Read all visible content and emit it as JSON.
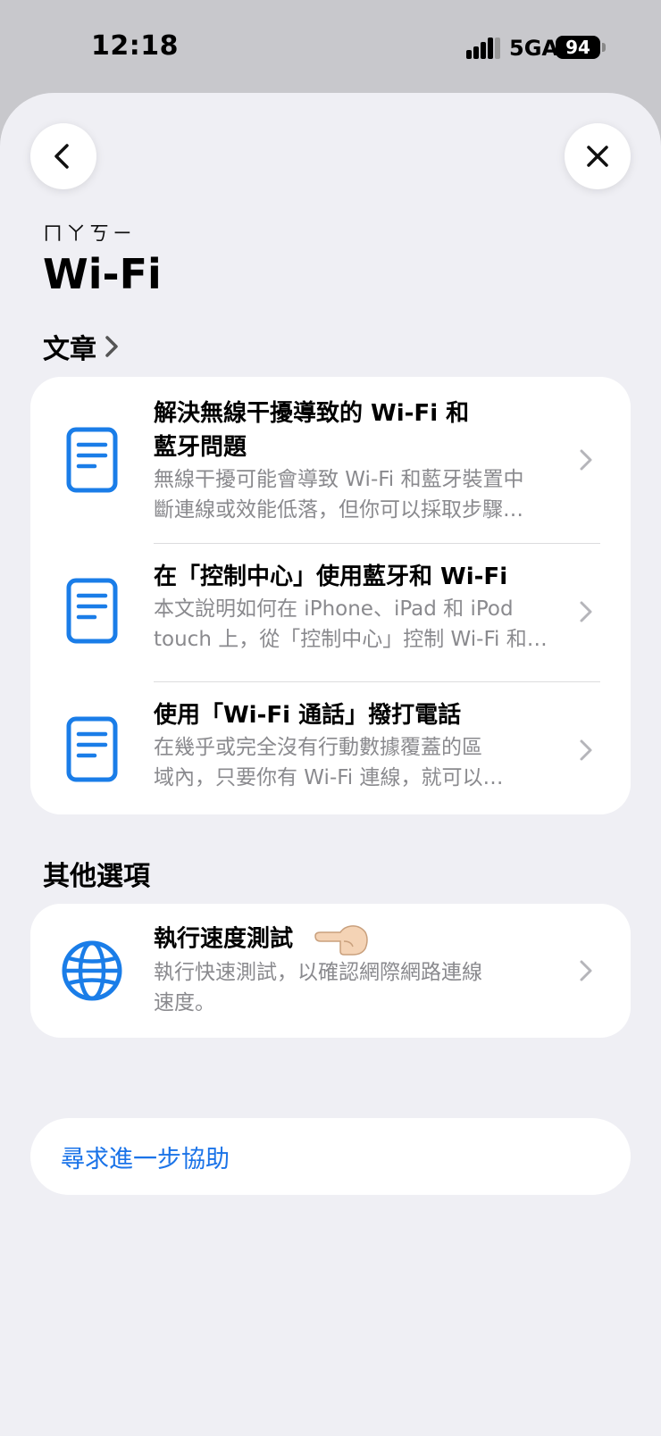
{
  "status_bar": {
    "time": "12:18",
    "network": "5GA",
    "battery": "94"
  },
  "header": {
    "eyebrow": "ㄇㄚㄎㄧ",
    "title": "Wi-Fi"
  },
  "articles": {
    "section_label": "文章",
    "items": [
      {
        "title_line1": "解決無線干擾導致的 Wi-Fi 和",
        "title_line2": "藍牙問題",
        "sub_line1": "無線干擾可能會導致 Wi-Fi 和藍牙裝置中",
        "sub_line2": "斷連線或效能低落，但你可以採取步驟…",
        "icon": "document-icon"
      },
      {
        "title_line1": "在「控制中心」使用藍牙和 Wi-Fi",
        "sub_line1": "本文說明如何在 iPhone、iPad 和 iPod",
        "sub_line2": "touch 上，從「控制中心」控制 Wi-Fi 和…",
        "icon": "document-icon"
      },
      {
        "title_line1": "使用「Wi-Fi 通話」撥打電話",
        "sub_line1": "在幾乎或完全沒有行動數據覆蓋的區",
        "sub_line2": "域內，只要你有 Wi-Fi 連線，就可以…",
        "icon": "document-icon"
      }
    ]
  },
  "other_options": {
    "section_label": "其他選項",
    "item": {
      "title": "執行速度測試",
      "sub_line1": "執行快速測試，以確認網際網路連線",
      "sub_line2": "速度。",
      "icon": "globe-icon"
    }
  },
  "help": {
    "label": "尋求進一步協助"
  },
  "colors": {
    "accent": "#1a73e8",
    "icon_blue": "#1a7de8",
    "sheet_bg": "#efeff4",
    "secondary_text": "#8a8a8e"
  }
}
